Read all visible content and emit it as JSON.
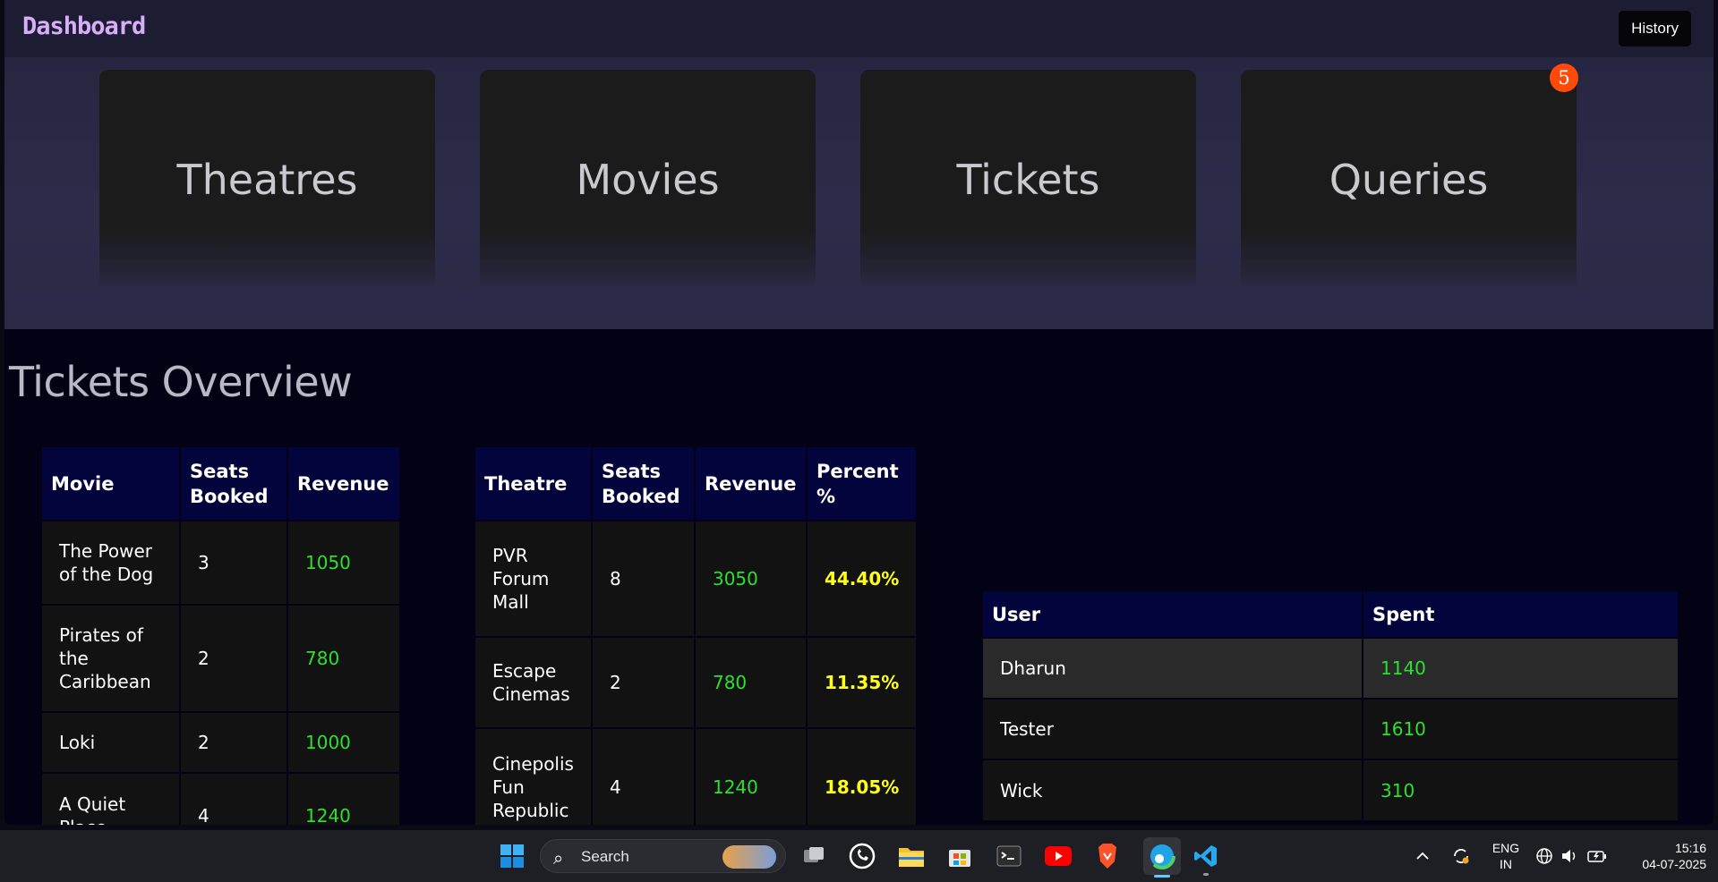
{
  "header": {
    "title": "Dashboard",
    "history_label": "History"
  },
  "cards": [
    {
      "label": "Theatres"
    },
    {
      "label": "Movies"
    },
    {
      "label": "Tickets"
    },
    {
      "label": "Queries",
      "badge": "5"
    }
  ],
  "section_title": "Tickets Overview",
  "movie_table": {
    "headers": [
      "Movie",
      "Seats Booked",
      "Revenue"
    ],
    "rows": [
      [
        "The Power of the Dog",
        "3",
        "1050"
      ],
      [
        "Pirates of the Caribbean",
        "2",
        "780"
      ],
      [
        "Loki",
        "2",
        "1000"
      ],
      [
        "A Quiet Place",
        "4",
        "1240"
      ]
    ]
  },
  "theatre_table": {
    "headers": [
      "Theatre",
      "Seats Booked",
      "Revenue",
      "Percent %"
    ],
    "rows": [
      [
        "PVR Forum Mall",
        "8",
        "3050",
        "44.40%"
      ],
      [
        "Escape Cinemas",
        "2",
        "780",
        "11.35%"
      ],
      [
        "Cinepolis Fun Republic",
        "4",
        "1240",
        "18.05%"
      ]
    ]
  },
  "user_table": {
    "headers": [
      "User",
      "Spent"
    ],
    "rows": [
      [
        "Dharun",
        "1140"
      ],
      [
        "Tester",
        "1610"
      ],
      [
        "Wick",
        "310"
      ]
    ]
  },
  "taskbar": {
    "search_placeholder": "Search",
    "lang_top": "ENG",
    "lang_bottom": "IN",
    "time": "15:16",
    "date": "04-07-2025"
  },
  "colors": {
    "accent_brand": "#d7aef7",
    "revenue": "#2ee02e",
    "percent": "#ffff1a",
    "badge": "#ff4a0a",
    "table_header": "#04043d"
  }
}
